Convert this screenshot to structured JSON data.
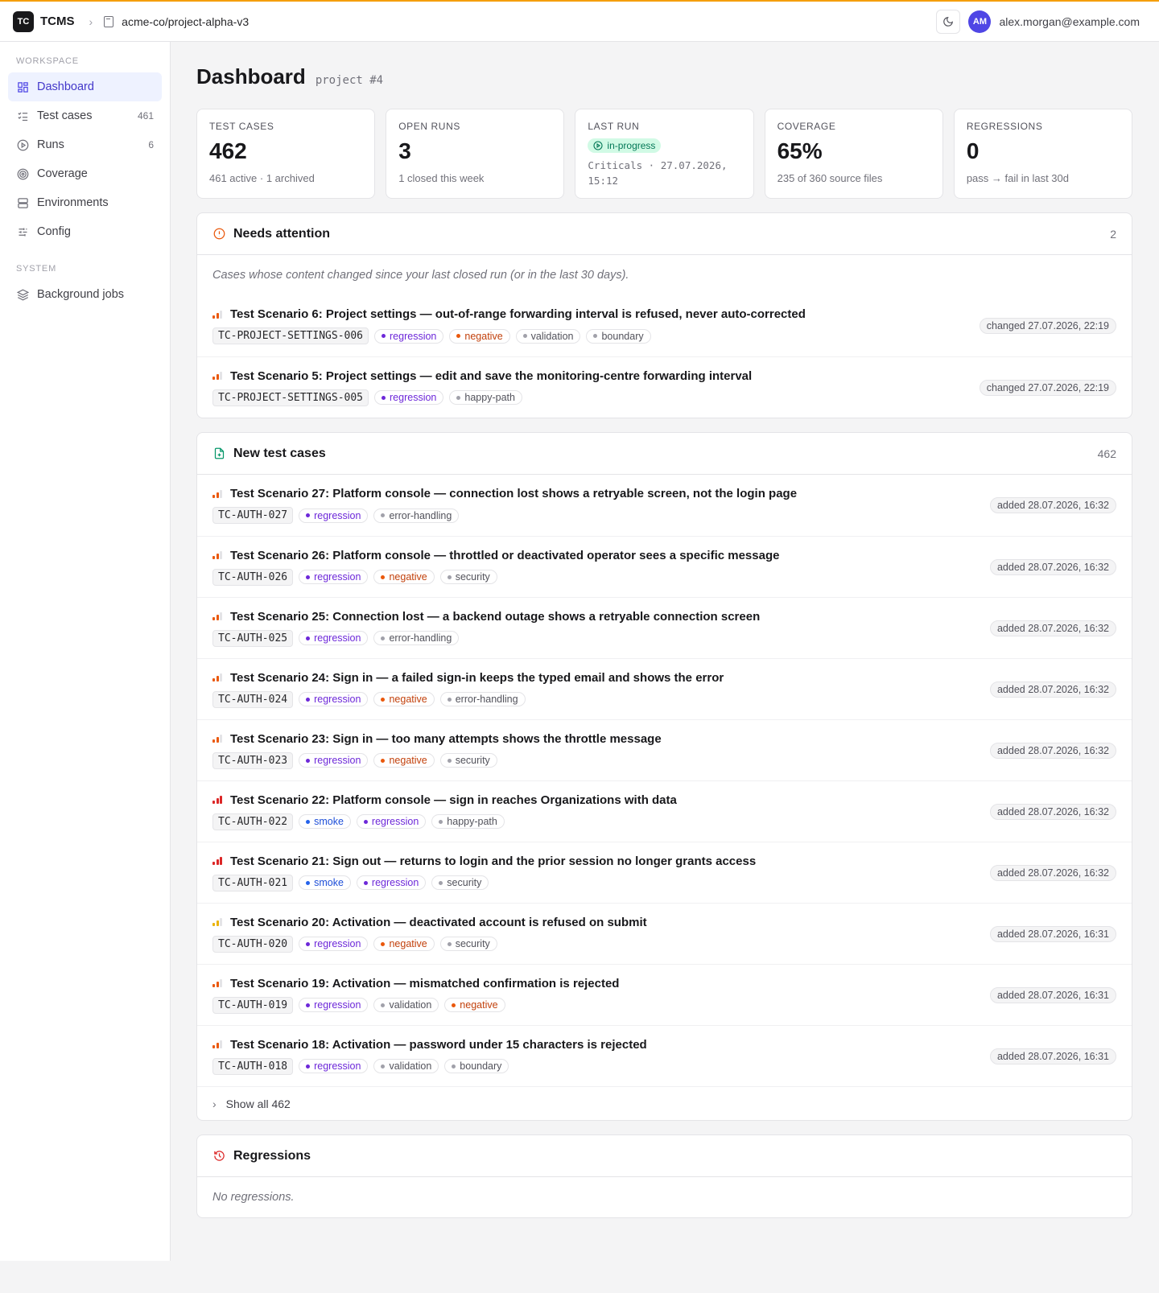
{
  "topbar": {
    "logo": "TC",
    "app_name": "TCMS",
    "repo": "acme-co/project-alpha-v3",
    "avatar_initials": "AM",
    "user_email": "alex.morgan@example.com"
  },
  "sidebar": {
    "workspace_label": "WORKSPACE",
    "system_label": "SYSTEM",
    "items": [
      {
        "label": "Dashboard",
        "count": "",
        "icon": "dashboard-icon",
        "active": true
      },
      {
        "label": "Test cases",
        "count": "461",
        "icon": "list-checks-icon"
      },
      {
        "label": "Runs",
        "count": "6",
        "icon": "play-circle-icon"
      },
      {
        "label": "Coverage",
        "count": "",
        "icon": "target-icon"
      },
      {
        "label": "Environments",
        "count": "",
        "icon": "server-icon"
      },
      {
        "label": "Config",
        "count": "",
        "icon": "sliders-icon"
      }
    ],
    "system_items": [
      {
        "label": "Background jobs",
        "icon": "layers-icon"
      }
    ]
  },
  "page": {
    "title": "Dashboard",
    "subtitle": "project #4"
  },
  "stats": {
    "test_cases": {
      "label": "TEST CASES",
      "value": "462",
      "note": "461 active · 1 archived"
    },
    "open_runs": {
      "label": "OPEN RUNS",
      "value": "3",
      "note": "1 closed this week"
    },
    "last_run": {
      "label": "LAST RUN",
      "status": "in-progress",
      "meta_line1": "Criticals · 27.07.2026,",
      "meta_line2": "15:12"
    },
    "coverage": {
      "label": "COVERAGE",
      "value": "65%",
      "note": "235 of 360 source files"
    },
    "regressions": {
      "label": "REGRESSIONS",
      "value": "0",
      "note": "pass → fail in last 30d"
    }
  },
  "needs_attention": {
    "title": "Needs attention",
    "count": "2",
    "description": "Cases whose content changed since your last closed run (or in the last 30 days).",
    "cases": [
      {
        "title": "Test Scenario 6: Project settings — out-of-range forwarding interval is refused, never auto-corrected",
        "id": "TC-PROJECT-SETTINGS-006",
        "priority": "medium",
        "tags": [
          "regression",
          "negative",
          "validation",
          "boundary"
        ],
        "stamp": "changed 27.07.2026, 22:19"
      },
      {
        "title": "Test Scenario 5: Project settings — edit and save the monitoring-centre forwarding interval",
        "id": "TC-PROJECT-SETTINGS-005",
        "priority": "medium",
        "tags": [
          "regression",
          "happy-path"
        ],
        "stamp": "changed 27.07.2026, 22:19"
      }
    ]
  },
  "new_cases": {
    "title": "New test cases",
    "count": "462",
    "show_all": "Show all 462",
    "cases": [
      {
        "title": "Test Scenario 27: Platform console — connection lost shows a retryable screen, not the login page",
        "id": "TC-AUTH-027",
        "priority": "medium",
        "tags": [
          "regression",
          "error-handling"
        ],
        "stamp": "added 28.07.2026, 16:32"
      },
      {
        "title": "Test Scenario 26: Platform console — throttled or deactivated operator sees a specific message",
        "id": "TC-AUTH-026",
        "priority": "medium",
        "tags": [
          "regression",
          "negative",
          "security"
        ],
        "stamp": "added 28.07.2026, 16:32"
      },
      {
        "title": "Test Scenario 25: Connection lost — a backend outage shows a retryable connection screen",
        "id": "TC-AUTH-025",
        "priority": "medium",
        "tags": [
          "regression",
          "error-handling"
        ],
        "stamp": "added 28.07.2026, 16:32"
      },
      {
        "title": "Test Scenario 24: Sign in — a failed sign-in keeps the typed email and shows the error",
        "id": "TC-AUTH-024",
        "priority": "medium",
        "tags": [
          "regression",
          "negative",
          "error-handling"
        ],
        "stamp": "added 28.07.2026, 16:32"
      },
      {
        "title": "Test Scenario 23: Sign in — too many attempts shows the throttle message",
        "id": "TC-AUTH-023",
        "priority": "medium",
        "tags": [
          "regression",
          "negative",
          "security"
        ],
        "stamp": "added 28.07.2026, 16:32"
      },
      {
        "title": "Test Scenario 22: Platform console — sign in reaches Organizations with data",
        "id": "TC-AUTH-022",
        "priority": "high",
        "tags": [
          "smoke",
          "regression",
          "happy-path"
        ],
        "stamp": "added 28.07.2026, 16:32"
      },
      {
        "title": "Test Scenario 21: Sign out — returns to login and the prior session no longer grants access",
        "id": "TC-AUTH-021",
        "priority": "high",
        "tags": [
          "smoke",
          "regression",
          "security"
        ],
        "stamp": "added 28.07.2026, 16:32"
      },
      {
        "title": "Test Scenario 20: Activation — deactivated account is refused on submit",
        "id": "TC-AUTH-020",
        "priority": "low",
        "tags": [
          "regression",
          "negative",
          "security"
        ],
        "stamp": "added 28.07.2026, 16:31"
      },
      {
        "title": "Test Scenario 19: Activation — mismatched confirmation is rejected",
        "id": "TC-AUTH-019",
        "priority": "medium",
        "tags": [
          "regression",
          "validation",
          "negative"
        ],
        "stamp": "added 28.07.2026, 16:31"
      },
      {
        "title": "Test Scenario 18: Activation — password under 15 characters is rejected",
        "id": "TC-AUTH-018",
        "priority": "medium",
        "tags": [
          "regression",
          "validation",
          "boundary"
        ],
        "stamp": "added 28.07.2026, 16:31"
      }
    ]
  },
  "regressions": {
    "title": "Regressions",
    "empty": "No regressions."
  }
}
